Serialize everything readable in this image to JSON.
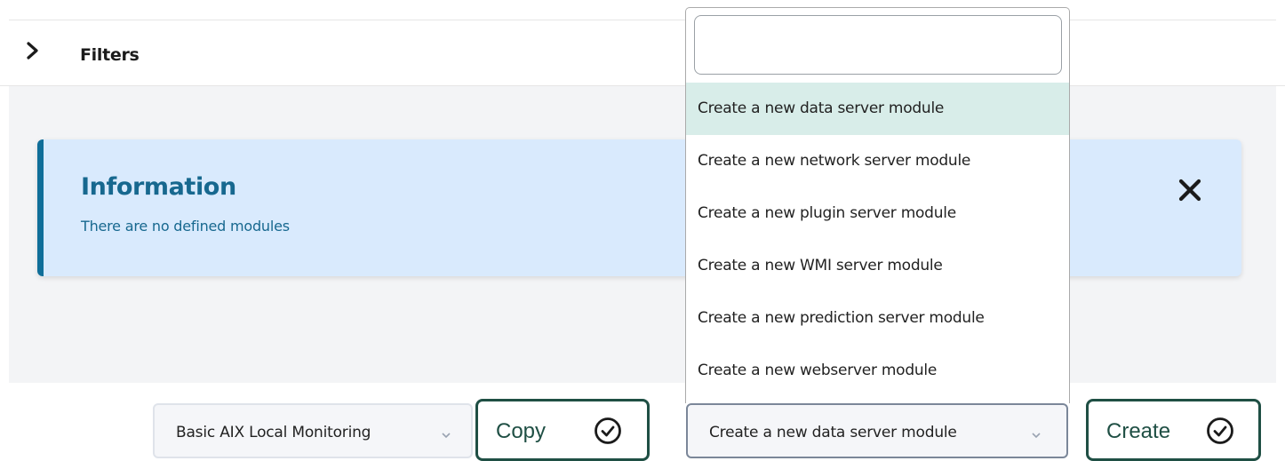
{
  "filters": {
    "label": "Filters"
  },
  "info": {
    "title": "Information",
    "message": "There are no defined modules"
  },
  "template_select": {
    "value": "Basic AIX Local Monitoring"
  },
  "copy_button": {
    "label": "Copy"
  },
  "module_select": {
    "value": "Create a new data server module",
    "search_value": "",
    "options": [
      "Create a new data server module",
      "Create a new network server module",
      "Create a new plugin server module",
      "Create a new WMI server module",
      "Create a new prediction server module",
      "Create a new webserver module"
    ],
    "highlighted_index": 0
  },
  "create_button": {
    "label": "Create"
  },
  "colors": {
    "info_background": "#d9eafd",
    "info_accent": "#0f6e99",
    "button_border": "#1f4f44",
    "option_highlight": "#d8ede9"
  },
  "icons": [
    "chevron-right-icon",
    "close-icon",
    "chevron-down-icon",
    "check-circle-icon"
  ]
}
